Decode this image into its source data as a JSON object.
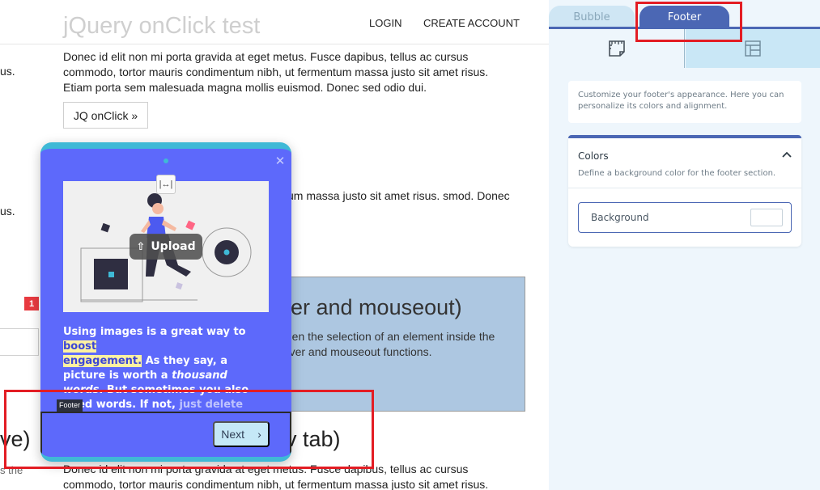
{
  "page": {
    "site_title": "jQuery onClick test",
    "nav": {
      "login": "LOGIN",
      "create_account": "CREATE ACCOUNT"
    },
    "paragraph_1": "Donec id elit non mi porta gravida at eget metus. Fusce dapibus, tellus ac cursus commodo, tortor mauris condimentum nibh, ut fermentum massa justo sit amet risus. Etiam porta sem malesuada magna mollis euismod. Donec sed odio dui.",
    "jq_button": "JQ onClick »",
    "paragraph_2": "us. Fusce dapibus, tellus ac cursus t fermentum massa justo sit amet risus. smod. Donec sed odio dui.",
    "side_fragment_1": "us.",
    "side_fragment_2": "us.",
    "badge": "1",
    "hover_box": {
      "title": "er and mouseout)",
      "text": "l then the selection of an element inside the eover and mouseout functions."
    },
    "heading_left_fragment": "ve)",
    "heading_right_fragment": "v tab)",
    "side_fragment_3": "s the",
    "paragraph_3": "Donec id elit non mi porta gravida at eget metus. Fusce dapibus, tellus ac cursus commodo, tortor mauris condimentum nibh, ut fermentum massa justo sit amet risus."
  },
  "popup": {
    "upload_label": "Upload",
    "text_part_1": "Using images is a great way to ",
    "highlight_1": "boost",
    "highlight_2": "engagement.",
    "text_part_2": " As they say, a picture is worth a ",
    "emphasis": "thousand words",
    "text_part_3": ". But sometimes you also need words. If not, ",
    "text_tail": "just delete them.",
    "footer_label": "Footer",
    "next_label": "Next"
  },
  "panel": {
    "tabs": {
      "bubble": "Bubble",
      "footer": "Footer"
    },
    "description": "Customize your footer's appearance. Here you can personalize its colors and alignment.",
    "colors": {
      "title": "Colors",
      "description": "Define a background color for the footer section.",
      "background_label": "Background",
      "background_value": "#ffffff"
    }
  },
  "colors": {
    "popup_bg": "#5d69fb",
    "popup_border": "#3fb9d6",
    "panel_accent": "#4b67b4",
    "highlight_red": "#e31d24"
  }
}
